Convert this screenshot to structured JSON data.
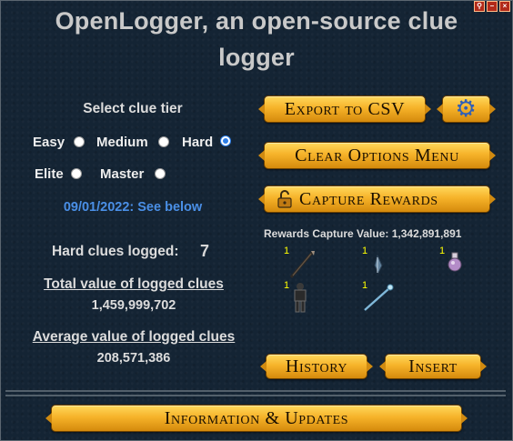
{
  "window": {
    "title": "OpenLogger, an open-source clue logger",
    "title_line1": "OpenLogger, an open-source clue",
    "title_line2": "logger"
  },
  "tier_select": {
    "heading": "Select clue tier",
    "options": [
      {
        "label": "Easy",
        "checked": false
      },
      {
        "label": "Medium",
        "checked": false
      },
      {
        "label": "Hard",
        "checked": true
      },
      {
        "label": "Elite",
        "checked": false
      },
      {
        "label": "Master",
        "checked": false
      }
    ]
  },
  "notice_link": "09/01/2022: See below",
  "stats": {
    "logged_label": "Hard clues logged:",
    "logged_count": "7",
    "total_label": "Total value of logged clues",
    "total_value": "1,459,999,702",
    "avg_label": "Average value of logged clues",
    "avg_value": "208,571,386"
  },
  "buttons": {
    "export": "Export to CSV",
    "settings_icon": "gear-icon",
    "clear": "Clear Options Menu",
    "capture": "Capture Rewards",
    "capture_icon": "unlocked-padlock-icon",
    "history": "History",
    "insert": "Insert",
    "info": "Information & Updates"
  },
  "rewards": {
    "capture_label": "Rewards Capture Value: 1,342,891,891",
    "items": [
      {
        "qty": "1",
        "icon": "dark-bow-icon"
      },
      {
        "qty": "1",
        "icon": "blue-feather-icon"
      },
      {
        "qty": "1",
        "icon": "purple-potion-icon"
      },
      {
        "qty": "1",
        "icon": "armour-figure-icon"
      },
      {
        "qty": "1",
        "icon": "blue-wand-icon"
      }
    ]
  },
  "colors": {
    "background": "#142434",
    "button_gold": "#f6b32a",
    "link_blue": "#4a8fe6",
    "quantity_yellow": "#ffff00"
  }
}
